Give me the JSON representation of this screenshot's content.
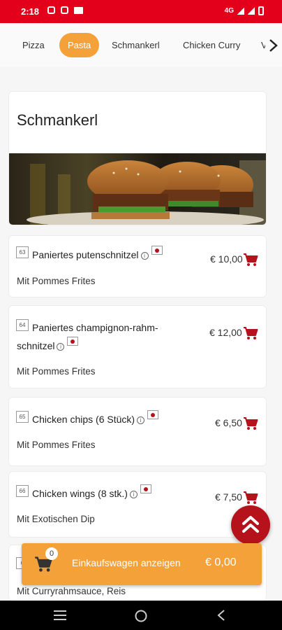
{
  "status_bar": {
    "time": "2:18",
    "network": "4G"
  },
  "tabs": [
    {
      "label": "Pizza",
      "active": false
    },
    {
      "label": "Pasta",
      "active": true
    },
    {
      "label": "Schmankerl",
      "active": false
    },
    {
      "label": "Chicken Curry",
      "active": false
    },
    {
      "label": "V",
      "active": false
    }
  ],
  "section": {
    "title": "Schmankerl"
  },
  "items": [
    {
      "number": "63",
      "name": "Paniertes putenschnitzel",
      "description": "Mit Pommes Frites",
      "price": "€ 10,00"
    },
    {
      "number": "64",
      "name_line1": "Paniertes champignon-rahm-",
      "name_line2": "schnitzel",
      "description": "Mit Pommes Frites",
      "price": "€ 12,00"
    },
    {
      "number": "65",
      "name": "Chicken chips (6 Stück)",
      "description": "Mit Pommes Frites",
      "price": "€ 6,50"
    },
    {
      "number": "66",
      "name": "Chicken wings (8 stk.)",
      "description": "Mit Exotischen Dip",
      "price": "€ 7,50"
    },
    {
      "number": "6",
      "description": "Mit Curryrahmsauce, Reis"
    }
  ],
  "cart": {
    "count": "0",
    "label": "Einkaufswagen anzeigen",
    "total": "€ 0,00"
  },
  "colors": {
    "status_bar": "#e3001b",
    "accent_orange": "#f5a13a",
    "accent_red": "#b5121b"
  },
  "icons": {
    "info": "i",
    "cart": "shopping-cart-icon",
    "scroll_top": "double-chevron-up-icon"
  }
}
